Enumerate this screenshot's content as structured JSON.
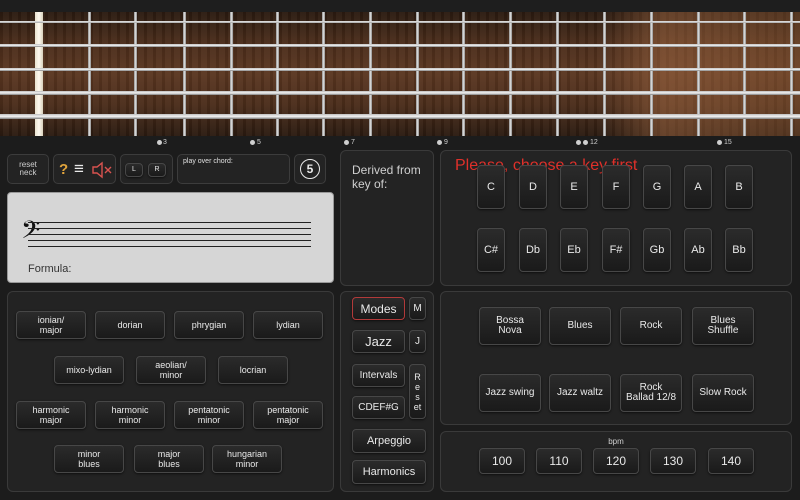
{
  "neck": {
    "fret_numbers": [
      "3",
      "5",
      "7",
      "9",
      "12",
      "15"
    ]
  },
  "controls": {
    "reset_neck_label": "reset\nneck",
    "help_glyph": "?",
    "menu_glyph": "≡",
    "mute_icon": "speaker-muted-icon",
    "left_label": "L",
    "right_label": "R",
    "play_over_chord_label": "play over chord:",
    "string_count": "5"
  },
  "staff": {
    "clef_glyph": "𝄢",
    "formula_label": "Formula:"
  },
  "derived": {
    "label": "Derived from key of:"
  },
  "keys": {
    "prompt": "Please, choose a key first",
    "row1": [
      "C",
      "D",
      "E",
      "F",
      "G",
      "A",
      "B"
    ],
    "row2": [
      "C#",
      "Db",
      "Eb",
      "F#",
      "Gb",
      "Ab",
      "Bb"
    ]
  },
  "scales": {
    "row1": [
      "ionian/\nmajor",
      "dorian",
      "phrygian",
      "lydian"
    ],
    "row2": [
      "mixo-lydian",
      "aeolian/\nminor",
      "locrian"
    ],
    "row3": [
      "harmonic\nmajor",
      "harmonic\nminor",
      "pentatonic\nminor",
      "pentatonic\nmajor"
    ],
    "row4": [
      "minor\nblues",
      "major\nblues",
      "hungarian\nminor"
    ]
  },
  "mode_buttons": {
    "modes": "Modes",
    "m": "M",
    "jazz": "Jazz",
    "j": "J",
    "intervals": "Intervals",
    "reset": "Reset",
    "cdef": "CDEF#G",
    "arpeggio": "Arpeggio",
    "harmonics": "Harmonics"
  },
  "styles": {
    "row1": [
      "Bossa\nNova",
      "Blues",
      "Rock",
      "Blues\nShuffle"
    ],
    "row2": [
      "Jazz swing",
      "Jazz waltz",
      "Rock\nBallad 12/8",
      "Slow Rock"
    ]
  },
  "tempo": {
    "label": "bpm",
    "values": [
      "100",
      "110",
      "120",
      "130",
      "140"
    ]
  },
  "colors": {
    "prompt_red": "#e0302a",
    "modes_border": "#b23a3a"
  }
}
